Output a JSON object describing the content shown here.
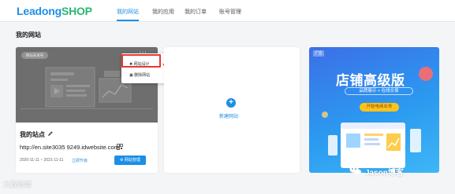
{
  "header": {
    "logo_part1": "Leadong",
    "logo_part2": "SHOP",
    "nav": [
      "我的网站",
      "我的应用",
      "我的订单",
      "账号管理"
    ],
    "active_index": 0
  },
  "section_title": "我的网站",
  "site_card": {
    "thumb_chip": "网站未发布",
    "name": "我的站点",
    "url": "http://en.site3035 9249.idwebsite.com",
    "dates": "2020-11-11 ~ 2021-11-11",
    "renew": "立即升级",
    "manage_button": "网站管理",
    "menu": [
      "网站设计",
      "删除网站"
    ]
  },
  "new_site_label": "新建网站",
  "ad": {
    "tag": "广告",
    "title": "店铺高级版",
    "subtitle": "品牌展示 + 在线交易",
    "button": "开始电商业务"
  },
  "watermarks": {
    "left": "大数跨境",
    "right": "Jason博客"
  },
  "colors": {
    "accent": "#1a8fe6",
    "highlight": "#e53935"
  }
}
